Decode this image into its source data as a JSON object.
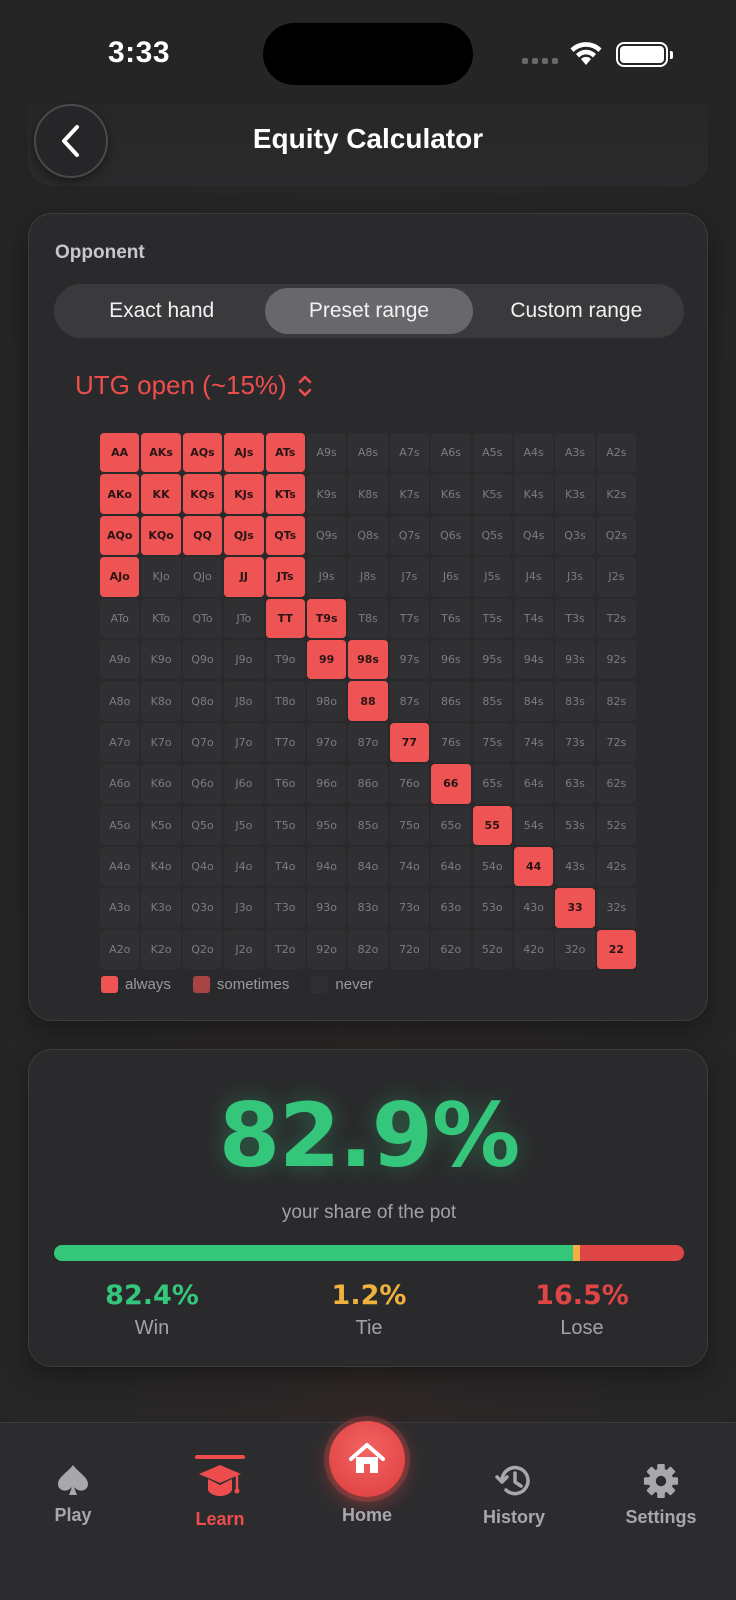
{
  "status_bar": {
    "time": "3:33"
  },
  "header": {
    "title": "Equity Calculator"
  },
  "opponent": {
    "label": "Opponent",
    "modes": [
      {
        "label": "Exact hand",
        "active": false
      },
      {
        "label": "Preset range",
        "active": true
      },
      {
        "label": "Custom range",
        "active": false
      }
    ],
    "range_preset": "UTG open (~15%)",
    "grid": [
      [
        "AA",
        "AKs",
        "AQs",
        "AJs",
        "ATs",
        "A9s",
        "A8s",
        "A7s",
        "A6s",
        "A5s",
        "A4s",
        "A3s",
        "A2s"
      ],
      [
        "AKo",
        "KK",
        "KQs",
        "KJs",
        "KTs",
        "K9s",
        "K8s",
        "K7s",
        "K6s",
        "K5s",
        "K4s",
        "K3s",
        "K2s"
      ],
      [
        "AQo",
        "KQo",
        "QQ",
        "QJs",
        "QTs",
        "Q9s",
        "Q8s",
        "Q7s",
        "Q6s",
        "Q5s",
        "Q4s",
        "Q3s",
        "Q2s"
      ],
      [
        "AJo",
        "KJo",
        "QJo",
        "JJ",
        "JTs",
        "J9s",
        "J8s",
        "J7s",
        "J6s",
        "J5s",
        "J4s",
        "J3s",
        "J2s"
      ],
      [
        "ATo",
        "KTo",
        "QTo",
        "JTo",
        "TT",
        "T9s",
        "T8s",
        "T7s",
        "T6s",
        "T5s",
        "T4s",
        "T3s",
        "T2s"
      ],
      [
        "A9o",
        "K9o",
        "Q9o",
        "J9o",
        "T9o",
        "99",
        "98s",
        "97s",
        "96s",
        "95s",
        "94s",
        "93s",
        "92s"
      ],
      [
        "A8o",
        "K8o",
        "Q8o",
        "J8o",
        "T8o",
        "98o",
        "88",
        "87s",
        "86s",
        "85s",
        "84s",
        "83s",
        "82s"
      ],
      [
        "A7o",
        "K7o",
        "Q7o",
        "J7o",
        "T7o",
        "97o",
        "87o",
        "77",
        "76s",
        "75s",
        "74s",
        "73s",
        "72s"
      ],
      [
        "A6o",
        "K6o",
        "Q6o",
        "J6o",
        "T6o",
        "96o",
        "86o",
        "76o",
        "66",
        "65s",
        "64s",
        "63s",
        "62s"
      ],
      [
        "A5o",
        "K5o",
        "Q5o",
        "J5o",
        "T5o",
        "95o",
        "85o",
        "75o",
        "65o",
        "55",
        "54s",
        "53s",
        "52s"
      ],
      [
        "A4o",
        "K4o",
        "Q4o",
        "J4o",
        "T4o",
        "94o",
        "84o",
        "74o",
        "64o",
        "54o",
        "44",
        "43s",
        "42s"
      ],
      [
        "A3o",
        "K3o",
        "Q3o",
        "J3o",
        "T3o",
        "93o",
        "83o",
        "73o",
        "63o",
        "53o",
        "43o",
        "33",
        "32s"
      ],
      [
        "A2o",
        "K2o",
        "Q2o",
        "J2o",
        "T2o",
        "92o",
        "82o",
        "72o",
        "62o",
        "52o",
        "42o",
        "32o",
        "22"
      ]
    ],
    "always_hands": [
      "AA",
      "AKs",
      "AQs",
      "AJs",
      "ATs",
      "AKo",
      "KK",
      "KQs",
      "KJs",
      "KTs",
      "AQo",
      "KQo",
      "QQ",
      "QJs",
      "QTs",
      "AJo",
      "JJ",
      "JTs",
      "TT",
      "T9s",
      "99",
      "98s",
      "88",
      "77",
      "66",
      "55",
      "44",
      "33",
      "22"
    ],
    "sometimes_hands": [],
    "legend": [
      {
        "label": "always",
        "color": "#ef5454"
      },
      {
        "label": "sometimes",
        "color": "#a94444"
      },
      {
        "label": "never",
        "color": "#303032"
      }
    ]
  },
  "equity": {
    "value": "82.9%",
    "caption": "your share of the pot",
    "win": 82.4,
    "tie": 1.2,
    "lose": 16.5,
    "stats": [
      {
        "value": "82.4%",
        "label": "Win",
        "color": "#34c77b"
      },
      {
        "value": "1.2%",
        "label": "Tie",
        "color": "#f0b13e"
      },
      {
        "value": "16.5%",
        "label": "Lose",
        "color": "#e04545"
      }
    ]
  },
  "tab_bar": {
    "tabs": [
      {
        "label": "Play",
        "icon": "spade-icon",
        "active": false
      },
      {
        "label": "Learn",
        "icon": "graduation-cap-icon",
        "active": true
      },
      {
        "label": "Home",
        "icon": "home-icon",
        "active": false
      },
      {
        "label": "History",
        "icon": "history-icon",
        "active": false
      },
      {
        "label": "Settings",
        "icon": "gear-icon",
        "active": false
      }
    ]
  },
  "colors": {
    "accent": "#ee4d4d",
    "win": "#34c77b",
    "tie": "#f0b13e",
    "lose": "#e04545"
  }
}
